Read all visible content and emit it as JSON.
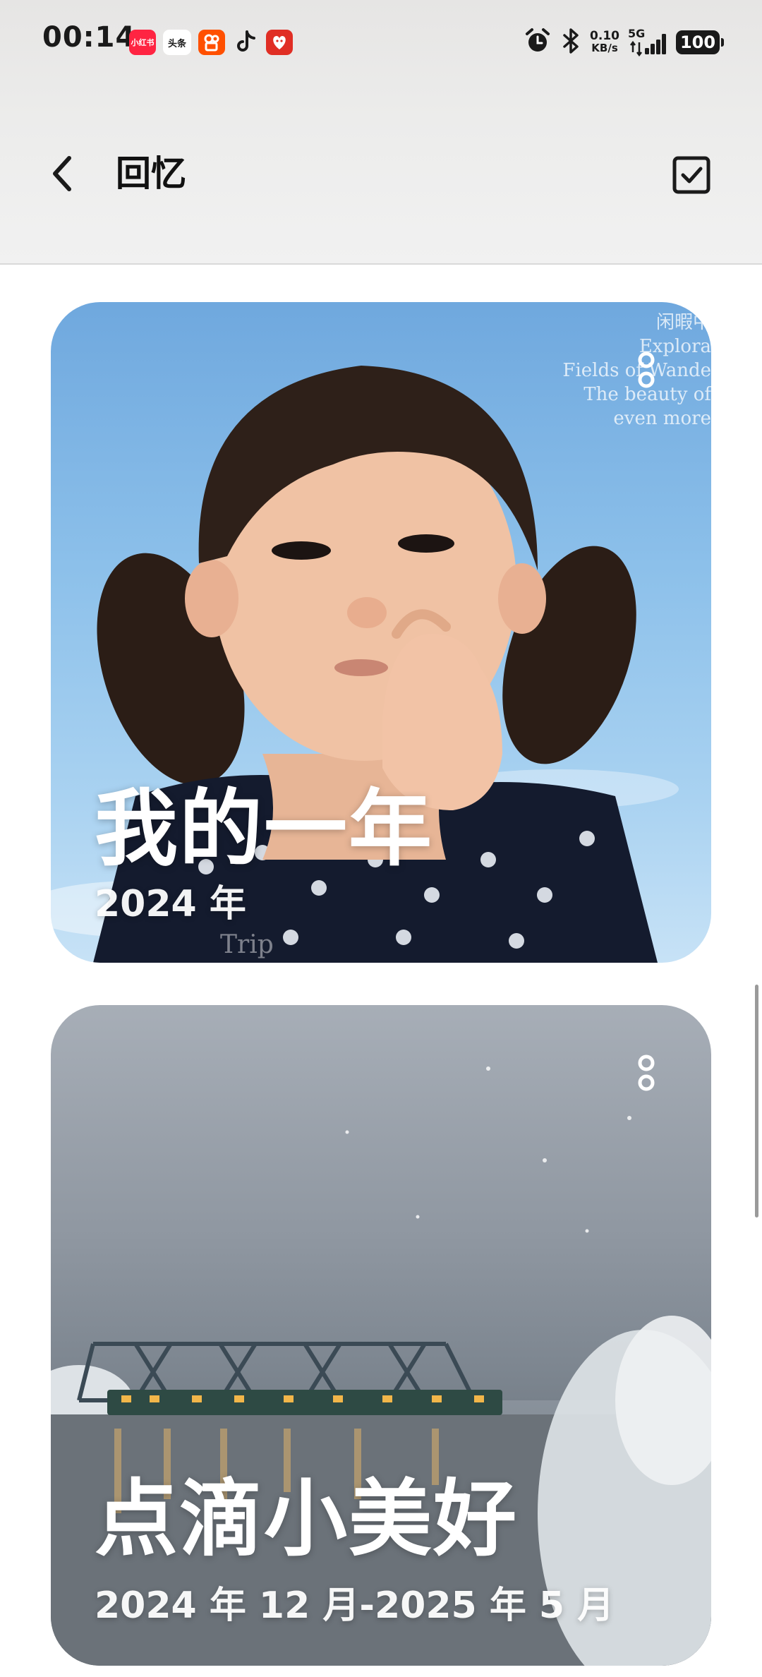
{
  "status_bar": {
    "time": "00:14",
    "app_icons": [
      {
        "name": "xiaohongshu-icon",
        "label": "小红书"
      },
      {
        "name": "toutiao-icon",
        "label": "头条"
      },
      {
        "name": "kuaishou-icon",
        "label": ""
      },
      {
        "name": "douyin-icon",
        "label": ""
      },
      {
        "name": "pinduoduo-icon",
        "label": ""
      }
    ],
    "net_speed": "0.10",
    "net_speed_unit": "KB/s",
    "network_type": "5G",
    "battery": "100"
  },
  "header": {
    "title": "回忆"
  },
  "memories": [
    {
      "title": "我的一年",
      "subtitle": "2024 年",
      "watermark_lines": [
        "闲暇中",
        "Explora",
        "Fields of Wande",
        "The beauty of",
        "even more"
      ],
      "watermark_bottom": "Trip"
    },
    {
      "title": "点滴小美好",
      "subtitle": "2024 年 12 月-2025 年 5 月"
    }
  ],
  "colors": {
    "accent": "#1a1a1a",
    "card_text": "#ffffff"
  }
}
